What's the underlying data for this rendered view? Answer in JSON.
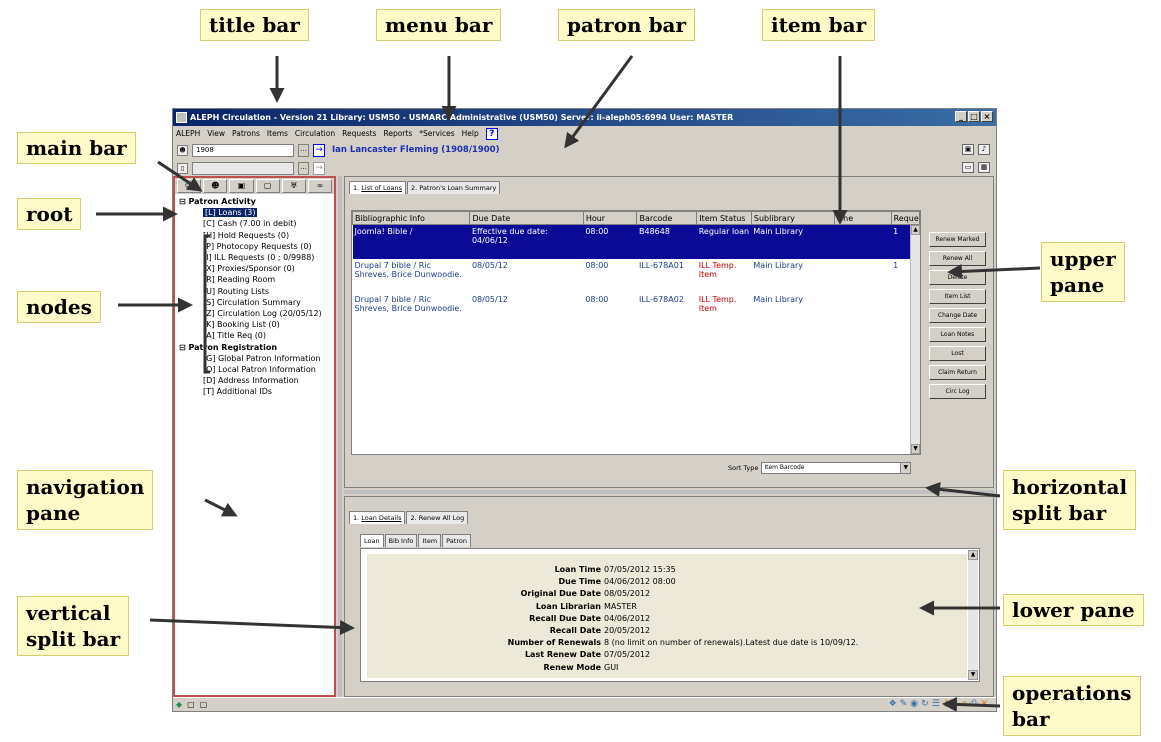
{
  "callouts": {
    "title_bar": "title bar",
    "menu_bar": "menu bar",
    "patron_bar": "patron bar",
    "item_bar": "item bar",
    "main_bar": "main bar",
    "root": "root",
    "nodes": "nodes",
    "navigation_pane_1": "navigation",
    "navigation_pane_2": "pane",
    "vertical_split_bar_1": "vertical",
    "vertical_split_bar_2": "split bar",
    "upper_pane_1": "upper",
    "upper_pane_2": "pane",
    "horizontal_split_bar_1": "horizontal",
    "horizontal_split_bar_2": "split bar",
    "lower_pane": "lower pane",
    "operations_bar_1": "operations",
    "operations_bar_2": "bar"
  },
  "app": {
    "title": "ALEPH Circulation - Version 21  Library: USM50 - USMARC Administrative (USM50)  Server: il-aleph05:6994  User: MASTER",
    "menu": [
      "ALEPH",
      "View",
      "Patrons",
      "Items",
      "Circulation",
      "Requests",
      "Reports",
      "*Services",
      "Help"
    ],
    "help_icon": "?",
    "patron_id": "1908",
    "patron_name": "Ian Lancaster Fleming (1908/1900)"
  },
  "nav": {
    "main_bar_icons": [
      "person-icon",
      "group-icon",
      "item-icon",
      "page-icon",
      "cup-icon",
      "binoculars-icon"
    ],
    "groups": [
      {
        "label": "Patron Activity",
        "nodes": [
          "[L] Loans (3)",
          "[C] Cash (7.00 in debit)",
          "[H] Hold Requests (0)",
          "[P] Photocopy Requests (0)",
          "[I] ILL Requests (0 ; 0/9988)",
          "[X] Proxies/Sponsor (0)",
          "[R] Reading Room",
          "[U] Routing Lists",
          "[S] Circulation Summary",
          "[Z] Circulation Log (20/05/12)",
          "[K] Booking List (0)",
          "[A] Title Req (0)"
        ]
      },
      {
        "label": "Patron Registration",
        "nodes": [
          "[G] Global Patron Information",
          "[O] Local Patron Information",
          "[D] Address Information",
          "[T] Additional IDs"
        ]
      }
    ]
  },
  "upper": {
    "tabs": [
      {
        "prefix": "1. ",
        "label": "List of Loans"
      },
      {
        "prefix": "2. ",
        "label": "Patron's Loan Summary"
      }
    ],
    "columns": [
      "Bibliographic Info",
      "Due Date",
      "Hour",
      "Barcode",
      "Item Status",
      "Sublibrary",
      "Fine",
      "Reque"
    ],
    "rows": [
      [
        "Joomla! Bible /",
        "Effective due date: 04/06/12",
        "08:00",
        "B48648",
        "Regular loan",
        "Main Library",
        "",
        "1"
      ],
      [
        "Drupal 7 bible / Ric Shreves, Brice Dunwoodie.",
        "08/05/12",
        "08:00",
        "ILL-678A01",
        "ILL Temp. Item",
        "Main Library",
        "",
        "1"
      ],
      [
        "Drupal 7 bible / Ric Shreves, Brice Dunwoodie.",
        "08/05/12",
        "08:00",
        "ILL-678A02",
        "ILL Temp. Item",
        "Main Library",
        "",
        ""
      ]
    ],
    "buttons": [
      "Renew Marked",
      "Renew All",
      "Delete",
      "Item List",
      "Change Date",
      "Loan Notes",
      "Lost",
      "Claim Return",
      "Circ Log"
    ],
    "sort_label": "Sort Type",
    "sort_value": "Item Barcode"
  },
  "lower": {
    "tabs": [
      {
        "prefix": "1. ",
        "label": "Loan Details"
      },
      {
        "prefix": "2. ",
        "label": "Renew All Log"
      }
    ],
    "subtabs": [
      "Loan",
      "Bib Info",
      "Item",
      "Patron"
    ],
    "details": [
      {
        "label": "Loan Time",
        "value": "07/05/2012 15:35"
      },
      {
        "label": "Due Time",
        "value": "04/06/2012 08:00"
      },
      {
        "label": "Original Due Date",
        "value": "08/05/2012"
      },
      {
        "label": "Loan Librarian",
        "value": "MASTER"
      },
      {
        "label": "Recall Due Date",
        "value": "04/06/2012"
      },
      {
        "label": "Recall Date",
        "value": "20/05/2012"
      },
      {
        "label": "Number of Renewals",
        "value": "8 (no limit on number of renewals).Latest due date is 10/09/12."
      },
      {
        "label": "Last Renew Date",
        "value": "07/05/2012"
      },
      {
        "label": "Renew Mode",
        "value": "GUI"
      }
    ]
  }
}
